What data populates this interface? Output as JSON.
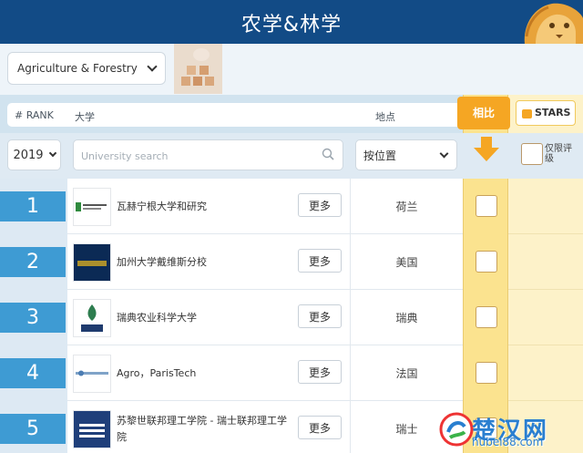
{
  "header": {
    "title": "农学&林学"
  },
  "subject": {
    "selected": "Agriculture & Forestry"
  },
  "columns": {
    "rank": "# RANK",
    "university": "大学",
    "location": "地点",
    "compare": "相比",
    "stars": "STARS"
  },
  "filters": {
    "year": "2019",
    "search_placeholder": "University search",
    "location_label": "按位置",
    "stars_only_label": "仅限评级"
  },
  "rows": [
    {
      "rank": "1",
      "name": "瓦赫宁根大学和研究",
      "country": "荷兰",
      "more": "更多",
      "logo": "wageningen-logo"
    },
    {
      "rank": "2",
      "name": "加州大学戴维斯分校",
      "country": "美国",
      "more": "更多",
      "logo": "ucdavis-logo"
    },
    {
      "rank": "3",
      "name": "瑞典农业科学大学",
      "country": "瑞典",
      "more": "更多",
      "logo": "slu-logo"
    },
    {
      "rank": "4",
      "name": "Agro，ParisTech",
      "country": "法国",
      "more": "更多",
      "logo": "agroparistech-logo"
    },
    {
      "rank": "5",
      "name": "苏黎世联邦理工学院 - 瑞士联邦理工学院",
      "country": "瑞士",
      "more": "更多",
      "logo": "eth-logo"
    }
  ],
  "watermark": {
    "site": "楚汉网",
    "url": "hubei88.com"
  },
  "colors": {
    "header": "#124b86",
    "rank": "#3e9bd3",
    "compare": "#f5a623",
    "compare_col": "#fbe38f"
  }
}
